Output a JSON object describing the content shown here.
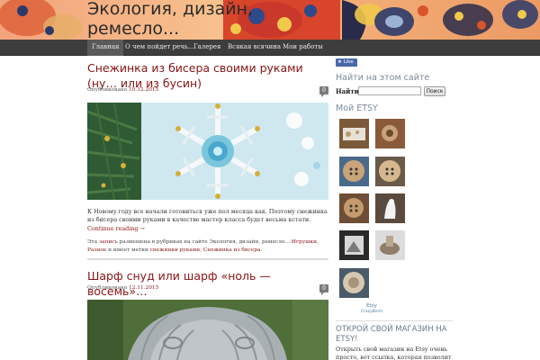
{
  "site": {
    "title": "Экология, дизайн, ремесло..."
  },
  "nav": {
    "items": [
      {
        "label": "Главная",
        "active": true
      },
      {
        "label": "О чем пойдет речь..."
      },
      {
        "label": "Галерея"
      },
      {
        "label": "Всякая всячина"
      },
      {
        "label": "Мои работы"
      }
    ]
  },
  "posts": [
    {
      "title": "Снежинка из бисера своими руками (ну… или из бусин)",
      "published_label": "Опубликовано",
      "date": "10.12.2015",
      "comments": "0",
      "image_icon": "beaded-snowflake-photo",
      "excerpt": "К Новому году все начали готовиться уже пол месяца как. Поэтому снежинка из бисера своими руками в качестве мастер класса будет весьма кстати.",
      "continue": "Continue reading →",
      "footer": {
        "prefix": "Эта",
        "entry_link": "запись",
        "middle": "размещена в рубриках на сайте Экология, дизайн, ремесло...:",
        "cat1": "Игрушки",
        "comma": ",",
        "cat2": "Разное",
        "and_tags": "и имеет метки",
        "tag1": "снежинки руками",
        "comma2": ",",
        "tag2": "Снежинка из бисера",
        "end": "."
      }
    },
    {
      "title": "Шарф снуд или шарф «ноль — восемь»…",
      "published_label": "Опубликовано",
      "date": "12.11.2015",
      "comments": "0",
      "image_icon": "knitted-snood-photo"
    }
  ],
  "sidebar": {
    "like_label": "Like",
    "search_heading": "Найти на этом сайте",
    "search_label": "Найти:",
    "search_value": "",
    "search_button": "Поиск",
    "etsy_heading": "Мой ETSY",
    "etsy_credit": "Etsy",
    "etsy_user": "CrazyBirch",
    "shop_heading": "ОТКРОЙ СВОЙ МАГАЗИН НА ETSY!",
    "shop_text": "Открыть свой магазин на Etsy очень просто, вот ссылка, которая позволит"
  },
  "colors": {
    "link": "#8a1212",
    "nav_bg": "#3d3d3d",
    "sidebar_heading": "#7a8a9a"
  }
}
